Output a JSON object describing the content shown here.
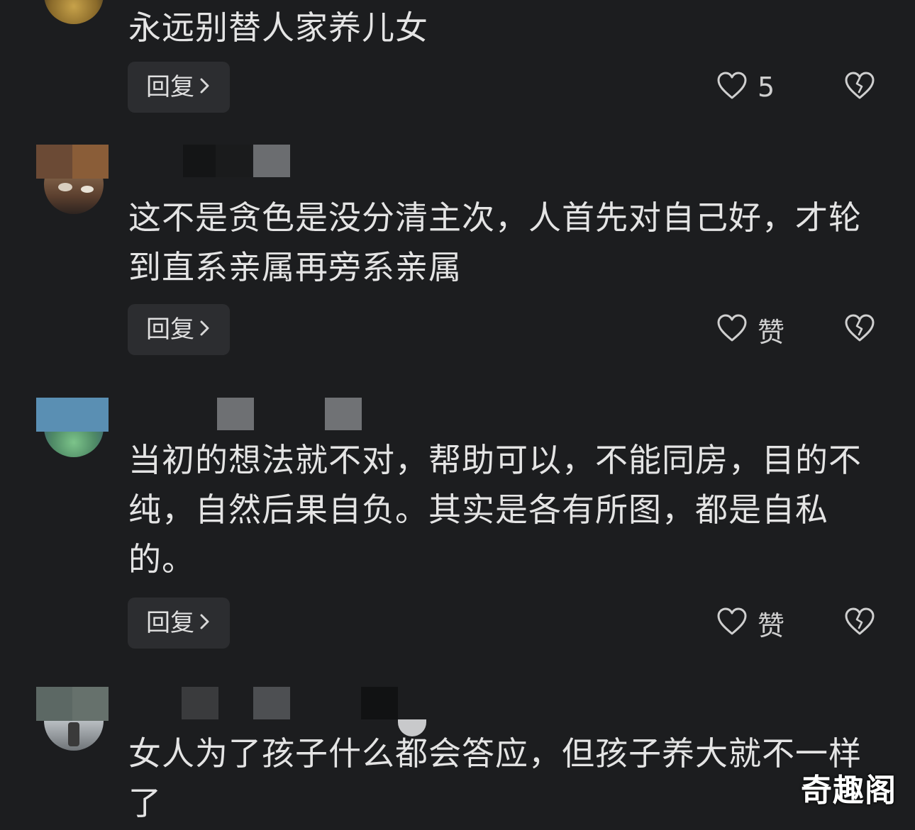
{
  "comments": [
    {
      "text_lines": [
        "永远别替人家养儿女"
      ],
      "reply_label": "回复",
      "like_label": "5"
    },
    {
      "text_lines": [
        "这不是贪色是没分清主次，人首先对自己好，才轮",
        "到直系亲属再旁系亲属"
      ],
      "reply_label": "回复",
      "like_label": "赞"
    },
    {
      "text_lines": [
        "当初的想法就不对，帮助可以，不能同房，目的不",
        "纯，自然后果自负。其实是各有所图，都是自私",
        "的。"
      ],
      "reply_label": "回复",
      "like_label": "赞"
    },
    {
      "text_lines": [
        "女人为了孩子什么都会答应，但孩子养大就不一样",
        "了"
      ]
    }
  ],
  "watermark": "奇趣阁",
  "icons": {
    "like": "heart-outline-icon",
    "dislike": "broken-heart-icon",
    "chevron": "chevron-right-icon"
  },
  "colors": {
    "background": "#1c1d1f",
    "text": "#e4e4e4",
    "button_bg": "#2c2d30"
  }
}
